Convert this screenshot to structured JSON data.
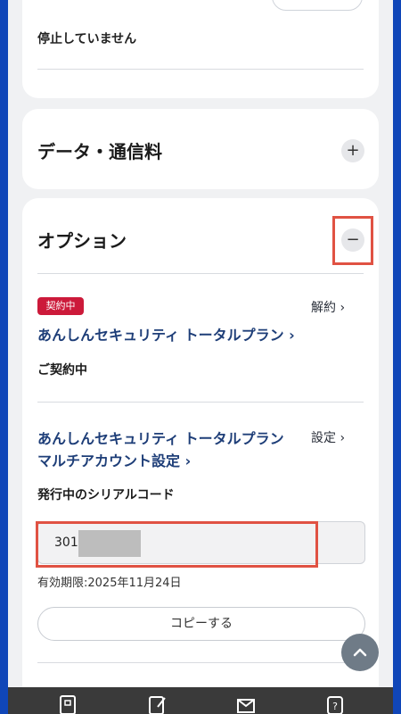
{
  "top_section": {
    "status_text": "停止していません"
  },
  "data_section": {
    "title": "データ・通信料",
    "toggle_symbol": "+"
  },
  "options_section": {
    "title": "オプション",
    "toggle_symbol": "−",
    "badge": "契約中",
    "cancel_link": "解約 ›",
    "plan_name": "あんしんセキュリティ トータルプラン ›",
    "contract_status": "ご契約中",
    "multi_account_line1": "あんしんセキュリティ トータルプラン",
    "multi_account_line2": "マルチアカウント設定 ›",
    "settings_link": "設定 ›",
    "serial_label": "発行中のシリアルコード",
    "serial_value": "301",
    "expiry": "有効期限:2025年11月24日",
    "copy_button": "コピーする"
  },
  "colors": {
    "frame": "#1046b8",
    "badge": "#cc1a3a",
    "link": "#1e3e78",
    "highlight": "#e05243"
  },
  "icons": [
    "chevron-up-icon",
    "home-icon",
    "edit-icon",
    "mail-icon",
    "help-icon"
  ]
}
